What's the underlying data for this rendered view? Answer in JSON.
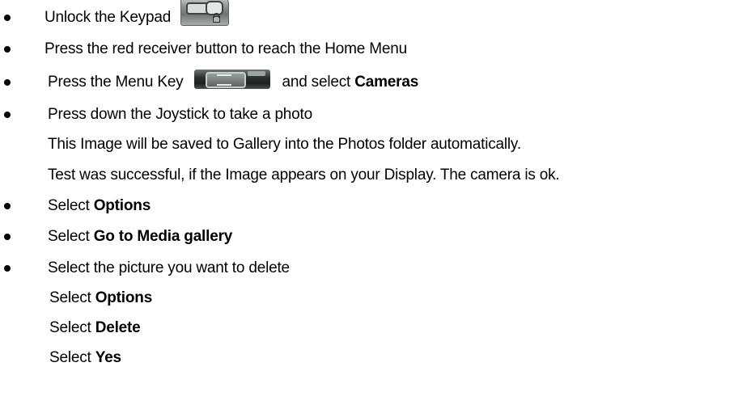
{
  "steps": {
    "s1": {
      "text": "Unlock the Keypad"
    },
    "s2": {
      "text": "Press the red receiver button to reach the Home Menu"
    },
    "s3": {
      "text_before": "Press the Menu Key",
      "text_after": "and select ",
      "bold": "Cameras"
    },
    "s4": {
      "text": "Press down the Joystick to take a photo"
    },
    "s4_note1": {
      "text": "This Image will be saved to Gallery into the Photos folder automatically."
    },
    "s4_note2": {
      "text": "Test was successful, if the Image appears on your Display. The camera is ok."
    },
    "s5": {
      "text": "Select ",
      "bold": "Options"
    },
    "s6": {
      "text": "Select ",
      "bold": "Go to Media gallery"
    },
    "s7": {
      "text": "Select the picture you want to delete"
    },
    "s7_sub1": {
      "text": "Select ",
      "bold": "Options"
    },
    "s7_sub2": {
      "text": "Select ",
      "bold": "Delete"
    },
    "s7_sub3": {
      "text": "Select ",
      "bold": "Yes"
    }
  },
  "images": {
    "keypad": "keypad-lock-icon",
    "menu_key": "menu-key-icon"
  }
}
